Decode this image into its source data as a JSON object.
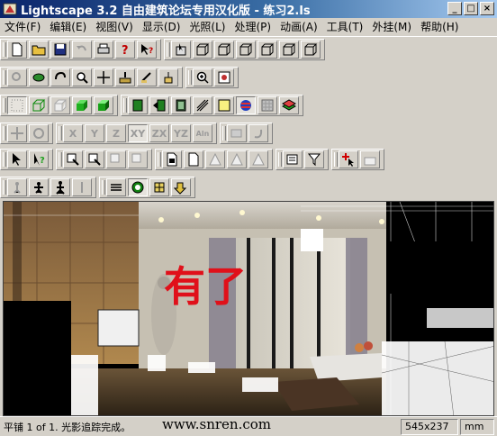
{
  "window": {
    "title": "Lightscape 3.2 自由建筑论坛专用汉化版 - 练习2.ls",
    "minimize_glyph": "_",
    "maximize_glyph": "□",
    "close_glyph": "×"
  },
  "menu": [
    {
      "label": "文件(F)"
    },
    {
      "label": "编辑(E)"
    },
    {
      "label": "视图(V)"
    },
    {
      "label": "显示(D)"
    },
    {
      "label": "光照(L)"
    },
    {
      "label": "处理(P)"
    },
    {
      "label": "动画(A)"
    },
    {
      "label": "工具(T)"
    },
    {
      "label": "外挂(M)"
    },
    {
      "label": "帮助(H)"
    }
  ],
  "toolbar": {
    "axis_x": "X",
    "axis_y": "Y",
    "axis_z": "Z",
    "plane_xy": "XY",
    "plane_zx": "ZX",
    "plane_yz": "YZ",
    "align": "Aln"
  },
  "viewport": {
    "overlay_text": "有了"
  },
  "status": {
    "message": "平铺 1 of 1. 光影追踪完成。",
    "watermark": "www.snren.com",
    "dimensions": "545x237",
    "unit": "mm"
  },
  "colors": {
    "title_start": "#0a246a",
    "title_end": "#a6caf0",
    "chrome": "#d4d0c8",
    "overlay_red": "#e0101a"
  }
}
